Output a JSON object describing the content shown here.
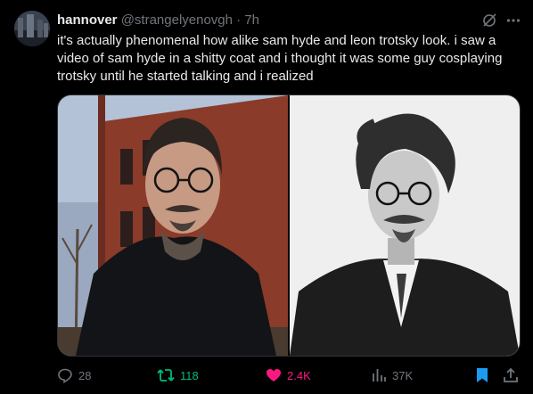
{
  "tweet": {
    "display_name": "hannover",
    "handle": "@strangelyenovgh",
    "separator": "·",
    "time": "7h",
    "text": "it's actually phenomenal how alike sam hyde and leon trotsky look. i saw a video of sam hyde in a shitty coat and i thought it was some guy cosplaying trotsky until he started talking and i realized"
  },
  "header_icons": [
    "grok-icon",
    "more-icon"
  ],
  "media": [
    {
      "kind": "photo",
      "subject": "color-photo-man-in-black-coat"
    },
    {
      "kind": "photo",
      "subject": "black-and-white-portrait"
    }
  ],
  "actions": {
    "replies": "28",
    "retweets": "118",
    "likes": "2.4K",
    "views": "37K"
  },
  "state": {
    "retweeted": true,
    "liked": true,
    "bookmarked": true
  },
  "colors": {
    "background": "#000000",
    "text": "#e7e9ea",
    "muted": "#71767b",
    "retweet": "#00ba7c",
    "like": "#f91880",
    "accent": "#1d9bf0"
  }
}
